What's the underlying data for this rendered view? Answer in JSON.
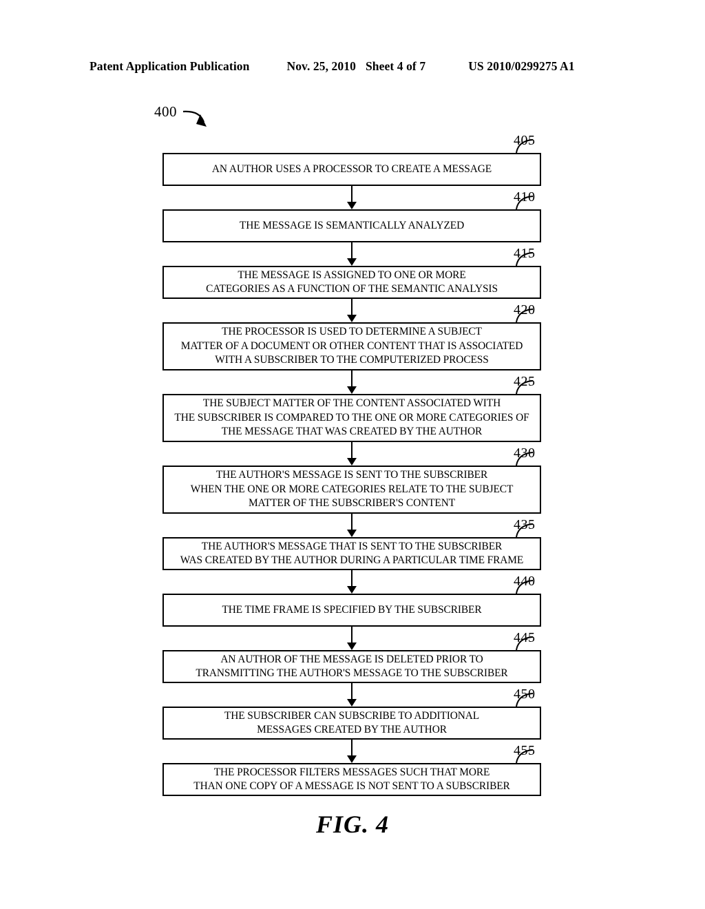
{
  "header": {
    "publication": "Patent Application Publication",
    "date": "Nov. 25, 2010",
    "sheet": "Sheet 4 of 7",
    "pub_number": "US 2010/0299275 A1"
  },
  "figure": {
    "tag": "400",
    "caption": "FIG. 4",
    "line_color": "#000000",
    "background": "#ffffff"
  },
  "flowchart": {
    "steps": [
      {
        "ref": "405",
        "lines": [
          "AN AUTHOR USES A PROCESSOR TO CREATE A MESSAGE"
        ]
      },
      {
        "ref": "410",
        "lines": [
          "THE MESSAGE IS SEMANTICALLY ANALYZED"
        ]
      },
      {
        "ref": "415",
        "lines": [
          "THE MESSAGE IS ASSIGNED TO ONE OR MORE",
          "CATEGORIES AS A FUNCTION OF THE SEMANTIC ANALYSIS"
        ]
      },
      {
        "ref": "420",
        "lines": [
          "THE PROCESSOR IS USED TO DETERMINE A SUBJECT",
          "MATTER OF A DOCUMENT OR OTHER CONTENT THAT IS ASSOCIATED",
          "WITH A SUBSCRIBER TO THE COMPUTERIZED PROCESS"
        ]
      },
      {
        "ref": "425",
        "lines": [
          "THE SUBJECT MATTER OF THE CONTENT ASSOCIATED WITH",
          "THE SUBSCRIBER IS COMPARED TO THE ONE OR MORE CATEGORIES OF",
          "THE MESSAGE THAT WAS CREATED BY THE AUTHOR"
        ]
      },
      {
        "ref": "430",
        "lines": [
          "THE AUTHOR'S MESSAGE IS SENT TO THE SUBSCRIBER",
          "WHEN THE ONE OR MORE CATEGORIES RELATE TO THE SUBJECT",
          "MATTER OF THE SUBSCRIBER'S CONTENT"
        ]
      },
      {
        "ref": "435",
        "lines": [
          "THE AUTHOR'S MESSAGE THAT IS SENT TO THE SUBSCRIBER",
          "WAS CREATED BY THE AUTHOR DURING A PARTICULAR TIME FRAME"
        ]
      },
      {
        "ref": "440",
        "lines": [
          "THE TIME FRAME IS SPECIFIED BY THE SUBSCRIBER"
        ]
      },
      {
        "ref": "445",
        "lines": [
          "AN AUTHOR OF THE MESSAGE IS DELETED PRIOR TO",
          "TRANSMITTING THE AUTHOR'S MESSAGE TO THE SUBSCRIBER"
        ]
      },
      {
        "ref": "450",
        "lines": [
          "THE SUBSCRIBER CAN SUBSCRIBE TO ADDITIONAL",
          "MESSAGES CREATED BY THE AUTHOR"
        ]
      },
      {
        "ref": "455",
        "lines": [
          "THE PROCESSOR FILTERS MESSAGES SUCH THAT MORE",
          "THAN ONE COPY OF A MESSAGE IS NOT SENT TO A SUBSCRIBER"
        ]
      }
    ]
  }
}
